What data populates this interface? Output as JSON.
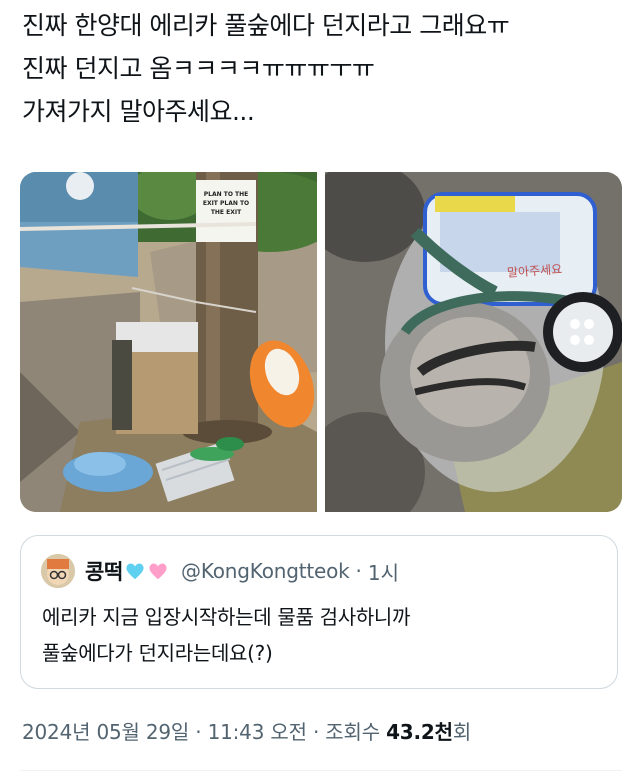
{
  "tweet": {
    "lines": [
      "진짜 한양대 에리카 풀숲에다 던지라고 그래요ㅠ",
      "진짜 던지고 옴ㅋㅋㅋㅋㅠㅠㅠㅜㅠ",
      "가져가지 말아주세요..."
    ]
  },
  "media": {
    "photo1": {
      "sign_text": "PLAN TO THE EXIT PLAN TO THE EXIT"
    },
    "photo2": {
      "bag_label": "말아주세요"
    }
  },
  "quote": {
    "name": "콩떡",
    "emojis": [
      "light-blue-heart-icon",
      "pink-heart-icon"
    ],
    "handle": "@KongKongtteok",
    "separator": "·",
    "time": "1시",
    "body_lines": [
      "에리카 지금 입장시작하는데 물품 검사하니까",
      "풀숲에다가 던지라는데요(?)"
    ]
  },
  "meta": {
    "timestamp": "2024년 05월 29일 · 11:43 오전",
    "separator": "·",
    "views_label_prefix": "조회수",
    "views_count": "43.2천",
    "views_label_suffix": "회"
  },
  "colors": {
    "text": "#0f1419",
    "secondary": "#536471",
    "border": "#cfd9de",
    "light_blue_heart": "#5fd0f0",
    "pink_heart": "#ff9fc9"
  }
}
